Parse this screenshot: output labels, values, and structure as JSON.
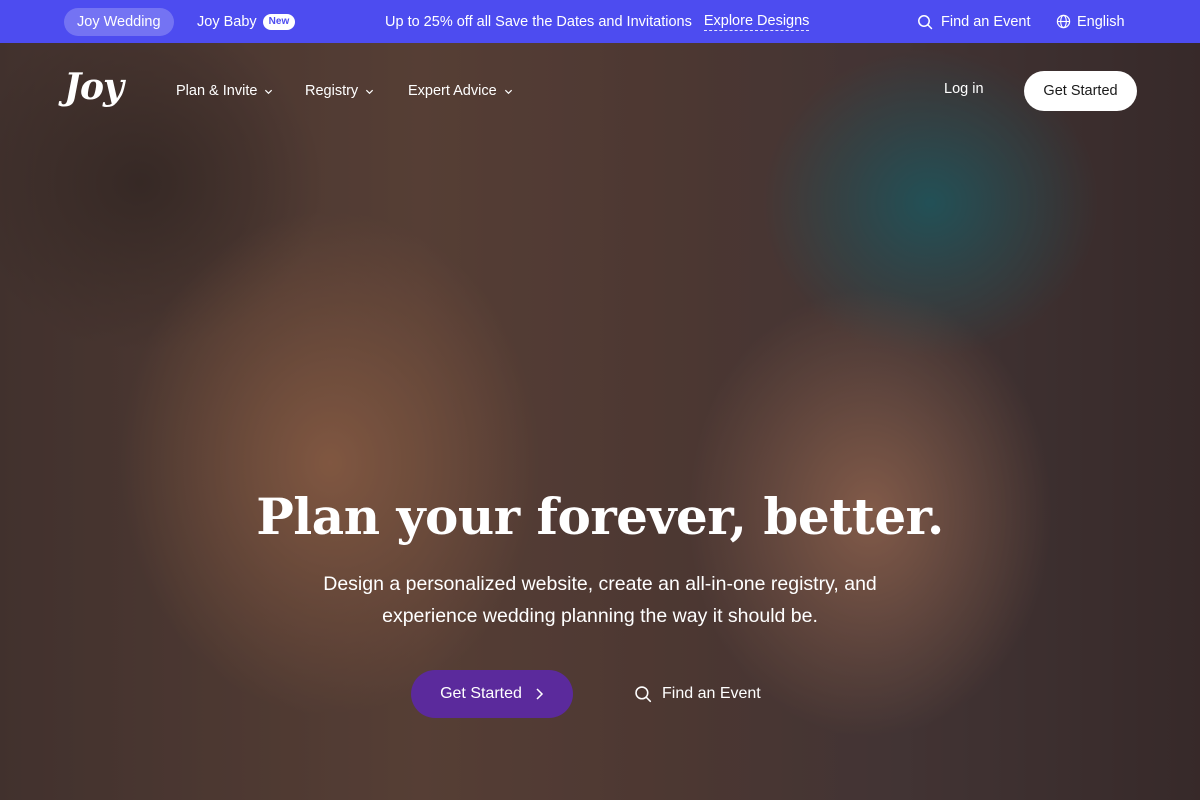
{
  "topbar": {
    "active_tab": "Joy Wedding",
    "baby_tab": "Joy Baby",
    "baby_badge": "New",
    "promo_text": "Up to 25% off all Save the Dates and Invitations",
    "promo_link": "Explore Designs",
    "find_event": "Find an Event",
    "language": "English",
    "colors": {
      "bar": "#4d4cf0"
    }
  },
  "nav": {
    "logo": "Joy",
    "items": [
      {
        "label": "Plan & Invite",
        "icon": "chevron-down-icon"
      },
      {
        "label": "Registry",
        "icon": "chevron-down-icon"
      },
      {
        "label": "Expert Advice",
        "icon": "chevron-down-icon"
      }
    ],
    "login": "Log in",
    "get_started": "Get Started"
  },
  "hero": {
    "headline": "Plan your forever, better.",
    "subtitle": "Design a personalized website, create an all-in-one registry, and experience wedding planning the way it should be.",
    "cta_primary": "Get Started",
    "cta_secondary": "Find an Event",
    "colors": {
      "cta": "#5b2a9c"
    }
  }
}
